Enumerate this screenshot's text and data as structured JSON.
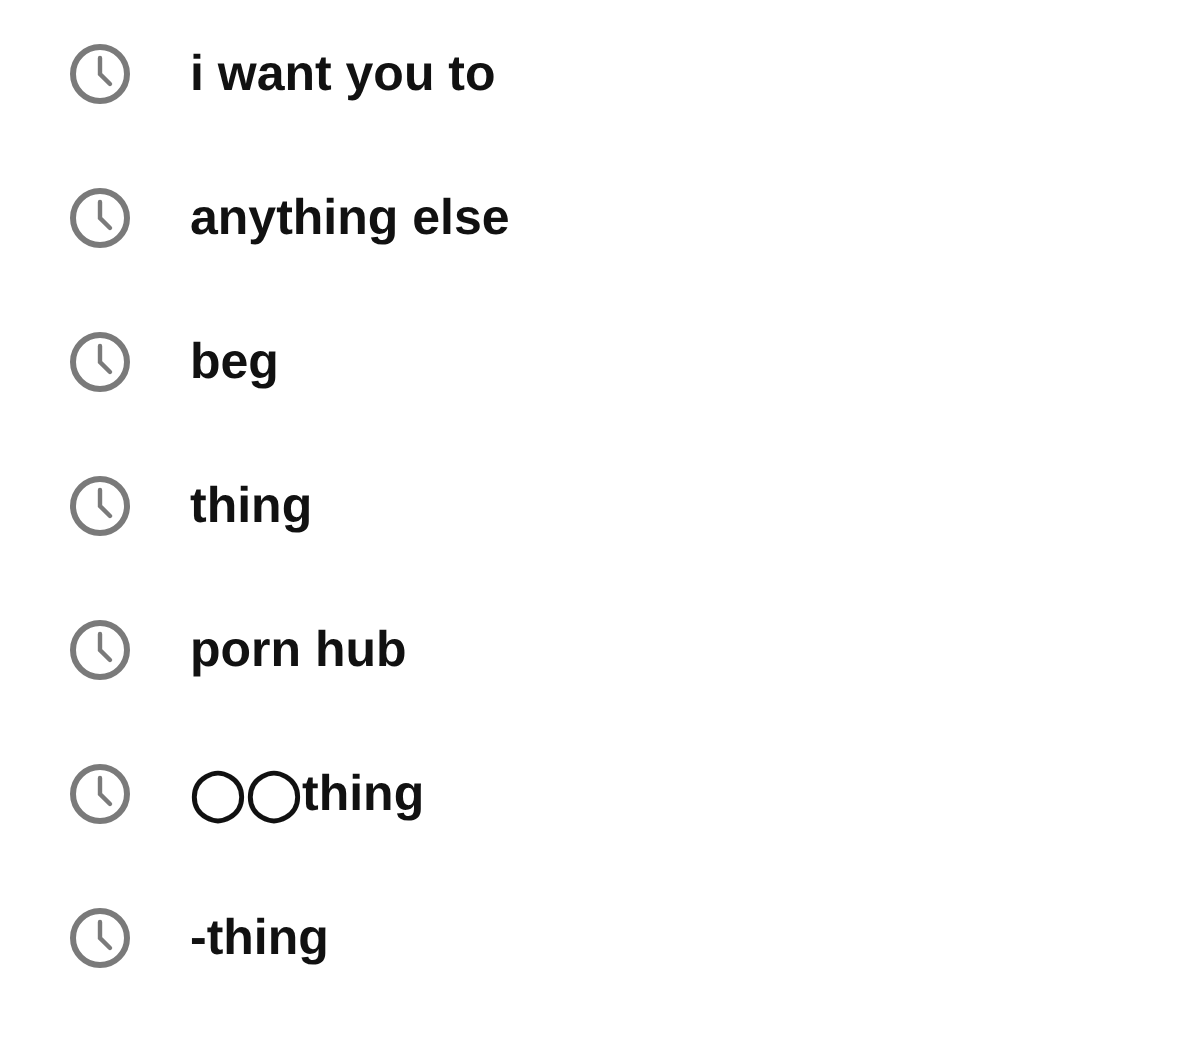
{
  "history": [
    {
      "query": "i want you to"
    },
    {
      "query": "anything else"
    },
    {
      "query": "beg"
    },
    {
      "query": "thing"
    },
    {
      "query": "porn hub"
    },
    {
      "query": "◯◯thing"
    },
    {
      "query": "-thing"
    }
  ]
}
